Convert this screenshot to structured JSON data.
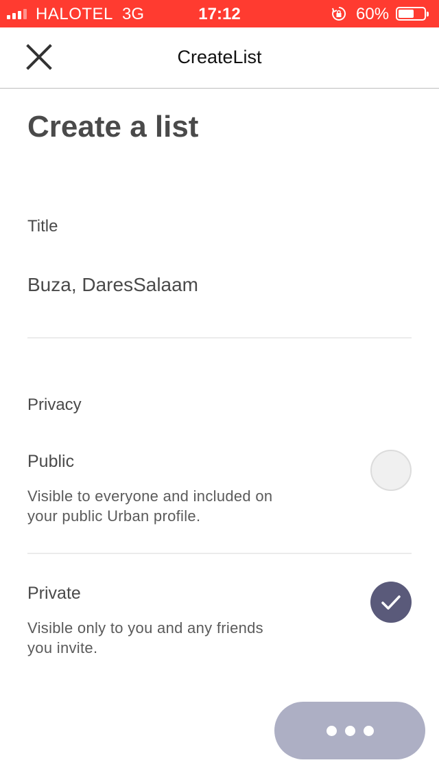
{
  "status_bar": {
    "carrier": "HALOTEL",
    "network": "3G",
    "time": "17:12",
    "battery_percent": "60%",
    "battery_level": 0.6,
    "background_color": "#ff3b30"
  },
  "nav": {
    "title": "CreateList",
    "close_icon": "close-icon"
  },
  "page": {
    "heading": "Create a list"
  },
  "title_field": {
    "label": "Title",
    "value": "Buza, DaresSalaam"
  },
  "privacy": {
    "label": "Privacy",
    "options": [
      {
        "label": "Public",
        "description": "Visible to everyone and included on your public Urban profile.",
        "selected": false
      },
      {
        "label": "Private",
        "description": "Visible only to you and any friends you invite.",
        "selected": true
      }
    ]
  },
  "actions": {
    "more_icon": "more-dots-icon",
    "button_color": "#adafc4"
  },
  "colors": {
    "text": "#4a4a4a",
    "selected_radio": "#5a5a7a"
  }
}
